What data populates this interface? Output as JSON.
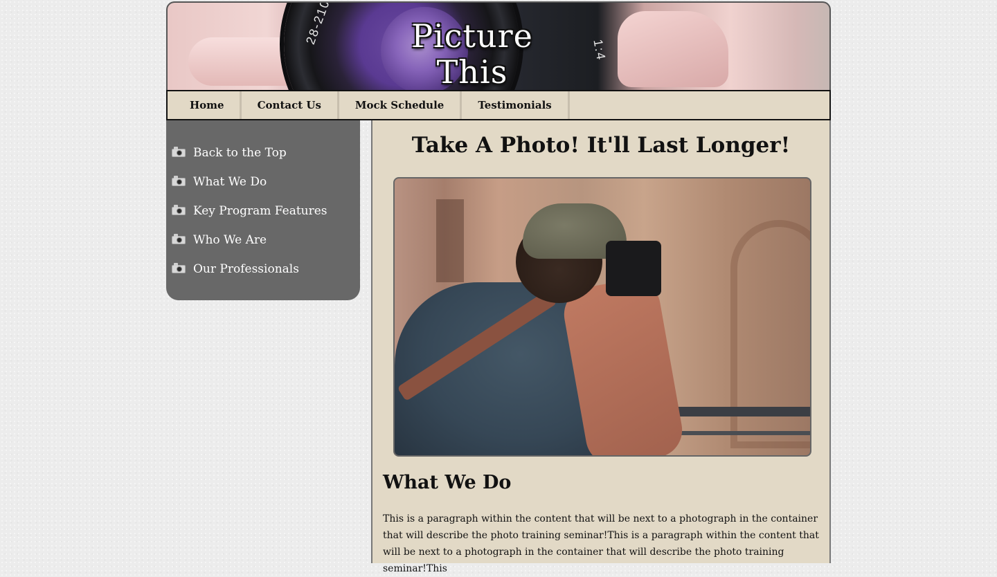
{
  "header": {
    "title_line1": "Picture",
    "title_line2": "This",
    "lens_text_left": "28-210",
    "lens_text_right": "1:4"
  },
  "nav": {
    "items": [
      {
        "label": "Home"
      },
      {
        "label": "Contact Us"
      },
      {
        "label": "Mock Schedule"
      },
      {
        "label": "Testimonials"
      }
    ]
  },
  "sidebar": {
    "items": [
      {
        "label": "Back to the Top",
        "icon": "camera-icon"
      },
      {
        "label": "What We Do",
        "icon": "camera-icon"
      },
      {
        "label": "Key Program Features",
        "icon": "camera-icon"
      },
      {
        "label": "Who We Are",
        "icon": "camera-icon"
      },
      {
        "label": "Our Professionals",
        "icon": "camera-icon"
      }
    ]
  },
  "main": {
    "heading": "Take A Photo! It'll Last Longer!",
    "section_heading": "What We Do",
    "paragraph": "This is a paragraph within the content that will be next to a photograph in the container that will describe the photo training seminar!This is a paragraph within the content that will be next to a photograph in the container that will describe the photo training seminar!This"
  },
  "colors": {
    "nav_background": "#e2d9c6",
    "sidebar_background": "#686868",
    "content_background": "#e2d9c6",
    "page_background": "#ececec"
  }
}
